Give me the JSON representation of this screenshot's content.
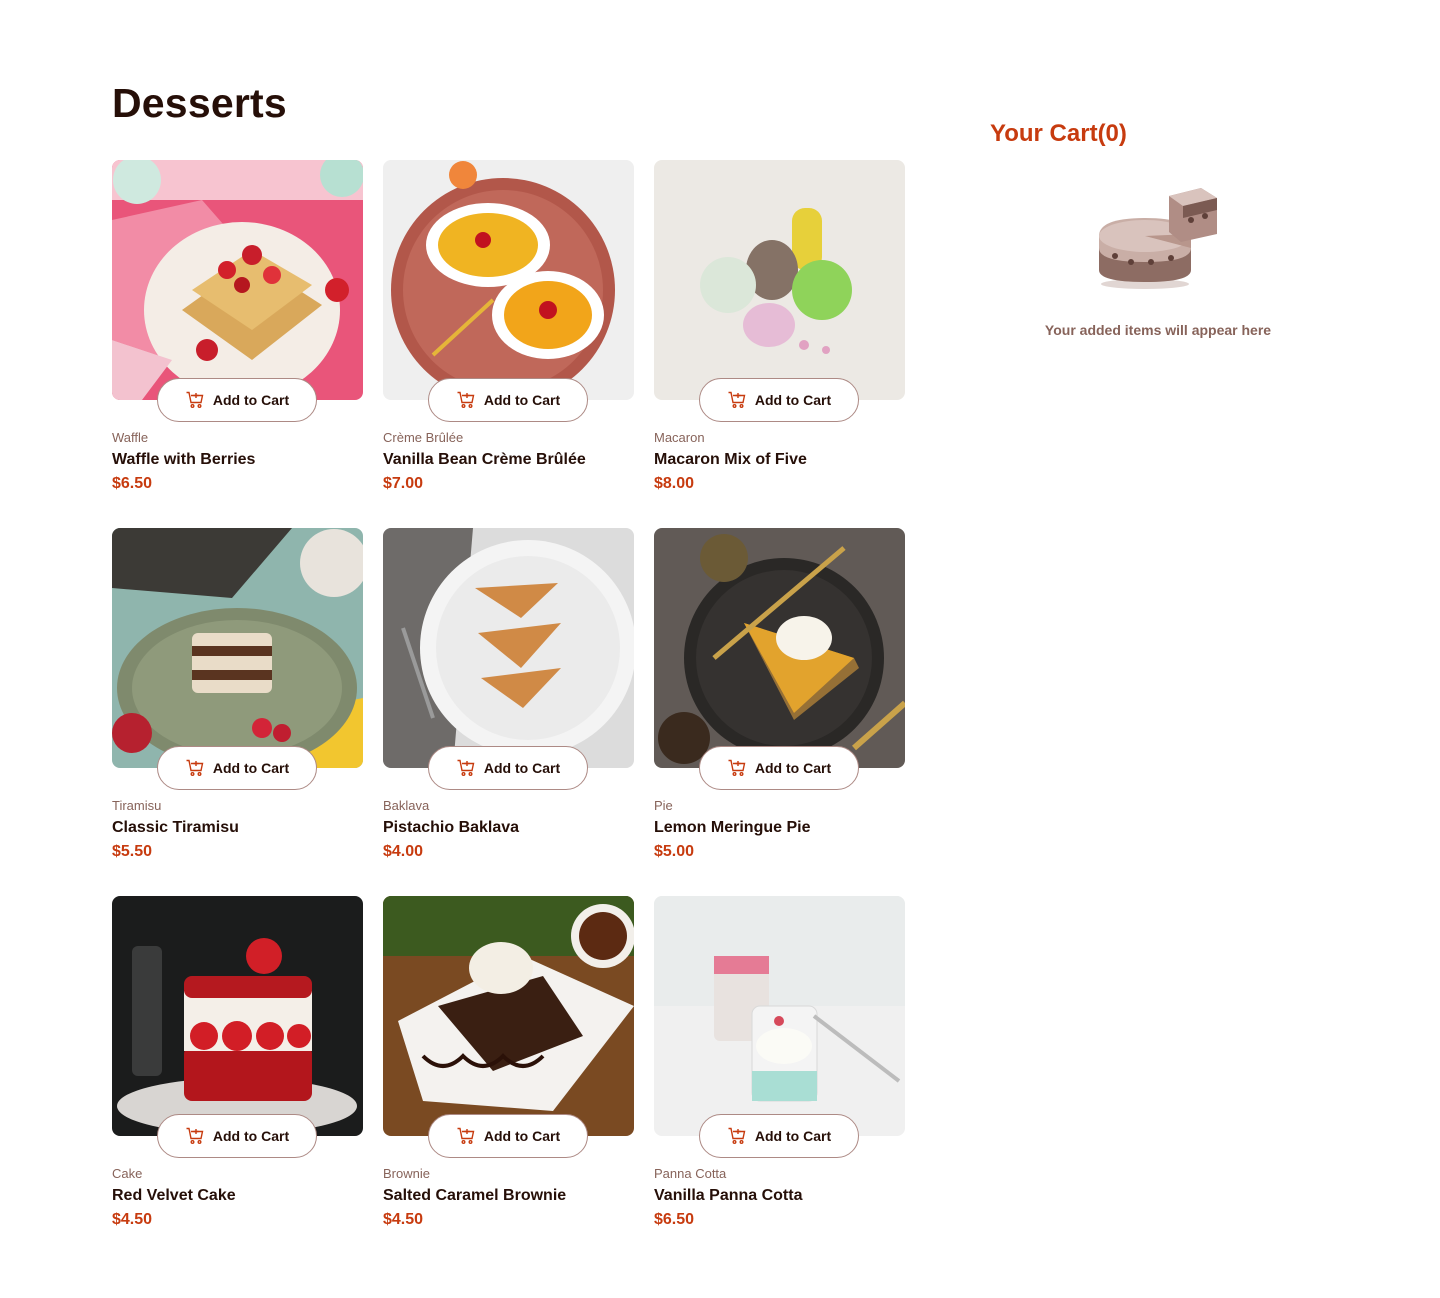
{
  "page": {
    "title": "Desserts"
  },
  "add_to_cart_label": "Add to Cart",
  "icons": {
    "cart": "add-to-cart-icon",
    "empty_cart": "empty-cart-cake-illustration"
  },
  "colors": {
    "accent": "#c73b0f",
    "text_dark": "#260f08",
    "text_muted": "#87635a",
    "border": "#ad8a85"
  },
  "products": [
    {
      "category": "Waffle",
      "name": "Waffle with Berries",
      "price": "$6.50"
    },
    {
      "category": "Crème Brûlée",
      "name": "Vanilla Bean Crème Brûlée",
      "price": "$7.00"
    },
    {
      "category": "Macaron",
      "name": "Macaron Mix of Five",
      "price": "$8.00"
    },
    {
      "category": "Tiramisu",
      "name": "Classic Tiramisu",
      "price": "$5.50"
    },
    {
      "category": "Baklava",
      "name": "Pistachio Baklava",
      "price": "$4.00"
    },
    {
      "category": "Pie",
      "name": "Lemon Meringue Pie",
      "price": "$5.00"
    },
    {
      "category": "Cake",
      "name": "Red Velvet Cake",
      "price": "$4.50"
    },
    {
      "category": "Brownie",
      "name": "Salted Caramel Brownie",
      "price": "$4.50"
    },
    {
      "category": "Panna Cotta",
      "name": "Vanilla Panna Cotta",
      "price": "$6.50"
    }
  ],
  "cart": {
    "title": "Your Cart(0)",
    "empty_text": "Your added items will appear here"
  }
}
